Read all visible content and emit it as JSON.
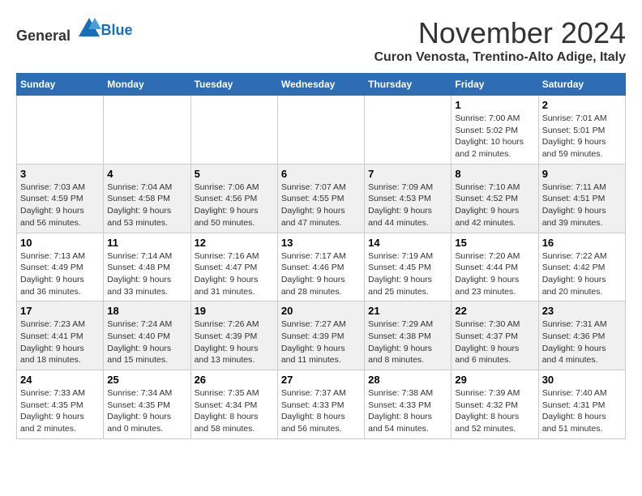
{
  "header": {
    "logo_general": "General",
    "logo_blue": "Blue",
    "month": "November 2024",
    "location": "Curon Venosta, Trentino-Alto Adige, Italy"
  },
  "days_of_week": [
    "Sunday",
    "Monday",
    "Tuesday",
    "Wednesday",
    "Thursday",
    "Friday",
    "Saturday"
  ],
  "weeks": [
    [
      {
        "day": "",
        "info": ""
      },
      {
        "day": "",
        "info": ""
      },
      {
        "day": "",
        "info": ""
      },
      {
        "day": "",
        "info": ""
      },
      {
        "day": "",
        "info": ""
      },
      {
        "day": "1",
        "info": "Sunrise: 7:00 AM\nSunset: 5:02 PM\nDaylight: 10 hours and 2 minutes."
      },
      {
        "day": "2",
        "info": "Sunrise: 7:01 AM\nSunset: 5:01 PM\nDaylight: 9 hours and 59 minutes."
      }
    ],
    [
      {
        "day": "3",
        "info": "Sunrise: 7:03 AM\nSunset: 4:59 PM\nDaylight: 9 hours and 56 minutes."
      },
      {
        "day": "4",
        "info": "Sunrise: 7:04 AM\nSunset: 4:58 PM\nDaylight: 9 hours and 53 minutes."
      },
      {
        "day": "5",
        "info": "Sunrise: 7:06 AM\nSunset: 4:56 PM\nDaylight: 9 hours and 50 minutes."
      },
      {
        "day": "6",
        "info": "Sunrise: 7:07 AM\nSunset: 4:55 PM\nDaylight: 9 hours and 47 minutes."
      },
      {
        "day": "7",
        "info": "Sunrise: 7:09 AM\nSunset: 4:53 PM\nDaylight: 9 hours and 44 minutes."
      },
      {
        "day": "8",
        "info": "Sunrise: 7:10 AM\nSunset: 4:52 PM\nDaylight: 9 hours and 42 minutes."
      },
      {
        "day": "9",
        "info": "Sunrise: 7:11 AM\nSunset: 4:51 PM\nDaylight: 9 hours and 39 minutes."
      }
    ],
    [
      {
        "day": "10",
        "info": "Sunrise: 7:13 AM\nSunset: 4:49 PM\nDaylight: 9 hours and 36 minutes."
      },
      {
        "day": "11",
        "info": "Sunrise: 7:14 AM\nSunset: 4:48 PM\nDaylight: 9 hours and 33 minutes."
      },
      {
        "day": "12",
        "info": "Sunrise: 7:16 AM\nSunset: 4:47 PM\nDaylight: 9 hours and 31 minutes."
      },
      {
        "day": "13",
        "info": "Sunrise: 7:17 AM\nSunset: 4:46 PM\nDaylight: 9 hours and 28 minutes."
      },
      {
        "day": "14",
        "info": "Sunrise: 7:19 AM\nSunset: 4:45 PM\nDaylight: 9 hours and 25 minutes."
      },
      {
        "day": "15",
        "info": "Sunrise: 7:20 AM\nSunset: 4:44 PM\nDaylight: 9 hours and 23 minutes."
      },
      {
        "day": "16",
        "info": "Sunrise: 7:22 AM\nSunset: 4:42 PM\nDaylight: 9 hours and 20 minutes."
      }
    ],
    [
      {
        "day": "17",
        "info": "Sunrise: 7:23 AM\nSunset: 4:41 PM\nDaylight: 9 hours and 18 minutes."
      },
      {
        "day": "18",
        "info": "Sunrise: 7:24 AM\nSunset: 4:40 PM\nDaylight: 9 hours and 15 minutes."
      },
      {
        "day": "19",
        "info": "Sunrise: 7:26 AM\nSunset: 4:39 PM\nDaylight: 9 hours and 13 minutes."
      },
      {
        "day": "20",
        "info": "Sunrise: 7:27 AM\nSunset: 4:39 PM\nDaylight: 9 hours and 11 minutes."
      },
      {
        "day": "21",
        "info": "Sunrise: 7:29 AM\nSunset: 4:38 PM\nDaylight: 9 hours and 8 minutes."
      },
      {
        "day": "22",
        "info": "Sunrise: 7:30 AM\nSunset: 4:37 PM\nDaylight: 9 hours and 6 minutes."
      },
      {
        "day": "23",
        "info": "Sunrise: 7:31 AM\nSunset: 4:36 PM\nDaylight: 9 hours and 4 minutes."
      }
    ],
    [
      {
        "day": "24",
        "info": "Sunrise: 7:33 AM\nSunset: 4:35 PM\nDaylight: 9 hours and 2 minutes."
      },
      {
        "day": "25",
        "info": "Sunrise: 7:34 AM\nSunset: 4:35 PM\nDaylight: 9 hours and 0 minutes."
      },
      {
        "day": "26",
        "info": "Sunrise: 7:35 AM\nSunset: 4:34 PM\nDaylight: 8 hours and 58 minutes."
      },
      {
        "day": "27",
        "info": "Sunrise: 7:37 AM\nSunset: 4:33 PM\nDaylight: 8 hours and 56 minutes."
      },
      {
        "day": "28",
        "info": "Sunrise: 7:38 AM\nSunset: 4:33 PM\nDaylight: 8 hours and 54 minutes."
      },
      {
        "day": "29",
        "info": "Sunrise: 7:39 AM\nSunset: 4:32 PM\nDaylight: 8 hours and 52 minutes."
      },
      {
        "day": "30",
        "info": "Sunrise: 7:40 AM\nSunset: 4:31 PM\nDaylight: 8 hours and 51 minutes."
      }
    ]
  ]
}
